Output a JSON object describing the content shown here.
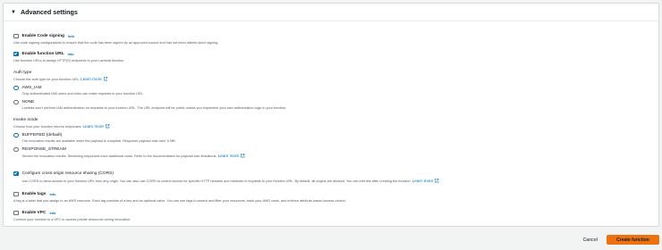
{
  "panel": {
    "title": "Advanced settings"
  },
  "code_signing": {
    "label": "Enable Code signing",
    "info": "Info",
    "desc": "Use code signing configurations to ensure that the code has been signed by an approved source and has not been altered since signing."
  },
  "function_url": {
    "label": "Enable function URL",
    "info": "Info",
    "desc": "Use function URLs to assign HTTP(S) endpoints to your Lambda function."
  },
  "auth_type": {
    "heading": "Auth type",
    "desc": "Choose the auth type for your function URL.",
    "learn_more": "Learn more",
    "options": [
      {
        "label": "AWS_IAM",
        "desc": "Only authenticated IAM users and roles can make requests to your function URL."
      },
      {
        "label": "NONE",
        "desc": "Lambda won't perform IAM authentication on requests to your function URL. The URL endpoint will be public unless you implement your own authorization logic in your function."
      }
    ]
  },
  "invoke_mode": {
    "heading": "Invoke mode",
    "desc": "Choose how your function returns responses.",
    "learn_more": "Learn more",
    "options": [
      {
        "label": "BUFFERED (default)",
        "desc": "The invocation results are available when the payload is complete. Response payload max size: 6 MB"
      },
      {
        "label": "RESPONSE_STREAM",
        "desc": "Stream the invocation results. Streaming responses incur additional costs. Refer to the documentation for payload size limitations.",
        "learn_more": "Learn more"
      }
    ]
  },
  "cors": {
    "label": "Configure cross-origin resource sharing (CORS)",
    "desc": "Use CORS to allow access to your function URL from any origin. You can also use CORS to control access for specific HTTP headers and methods in requests to your function URL. By default, all origins are allowed. You can edit this after creating the function.",
    "learn_more": "Learn more"
  },
  "tags": {
    "label": "Enable tags",
    "info": "Info",
    "desc": "A tag is a label that you assign to an AWS resource. Each tag consists of a key and an optional value. You can use tags to search and filter your resources, track your AWS costs, and enforce attribute-based access control."
  },
  "vpc": {
    "label": "Enable VPC",
    "info": "Info",
    "desc": "Connect your function to a VPC to access private resources during invocation."
  },
  "footer": {
    "cancel": "Cancel",
    "create": "Create function"
  }
}
